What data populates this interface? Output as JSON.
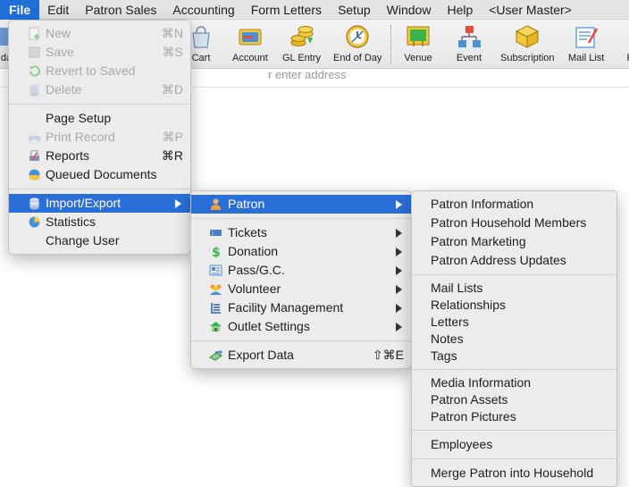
{
  "menubar": [
    {
      "label": "File",
      "active": true
    },
    {
      "label": "Edit"
    },
    {
      "label": "Patron Sales"
    },
    {
      "label": "Accounting"
    },
    {
      "label": "Form Letters"
    },
    {
      "label": "Setup"
    },
    {
      "label": "Window"
    },
    {
      "label": "Help"
    },
    {
      "label": "<User Master>"
    }
  ],
  "toolbar": {
    "left_partial": "da",
    "cart": "Cart",
    "account": "Account",
    "gl_entry": "GL Entry",
    "end_of_day": "End of Day",
    "venue": "Venue",
    "event": "Event",
    "subscription": "Subscription",
    "mail_list": "Mail List",
    "right_partial": "Pr"
  },
  "address_placeholder": "r enter address",
  "file_menu": {
    "new": {
      "label": "New",
      "shortcut": "⌘N"
    },
    "save": {
      "label": "Save",
      "shortcut": "⌘S"
    },
    "revert": {
      "label": "Revert to Saved"
    },
    "delete": {
      "label": "Delete",
      "shortcut": "⌘D"
    },
    "page_setup": {
      "label": "Page Setup"
    },
    "print_record": {
      "label": "Print Record",
      "shortcut": "⌘P"
    },
    "reports": {
      "label": "Reports",
      "shortcut": "⌘R"
    },
    "queued": {
      "label": "Queued Documents"
    },
    "import_export": {
      "label": "Import/Export"
    },
    "statistics": {
      "label": "Statistics"
    },
    "change_user": {
      "label": "Change User"
    }
  },
  "import_export_menu": {
    "patron": "Patron",
    "tickets": "Tickets",
    "donation": "Donation",
    "pass_gc": "Pass/G.C.",
    "volunteer": "Volunteer",
    "facility": "Facility Management",
    "outlet": "Outlet Settings",
    "export_data": {
      "label": "Export Data",
      "shortcut": "⇧⌘E"
    }
  },
  "patron_menu": {
    "group1": [
      "Patron Information",
      "Patron Household Members",
      "Patron Marketing",
      "Patron Address Updates"
    ],
    "group2": [
      "Mail Lists",
      "Relationships",
      "Letters",
      "Notes",
      "Tags"
    ],
    "group3": [
      "Media Information",
      "Patron Assets",
      "Patron Pictures"
    ],
    "group4": [
      "Employees"
    ],
    "group5": [
      "Merge Patron into Household"
    ]
  },
  "colors": {
    "highlight": "#2a6fd8",
    "menubar_active": "#1f6fd8"
  }
}
